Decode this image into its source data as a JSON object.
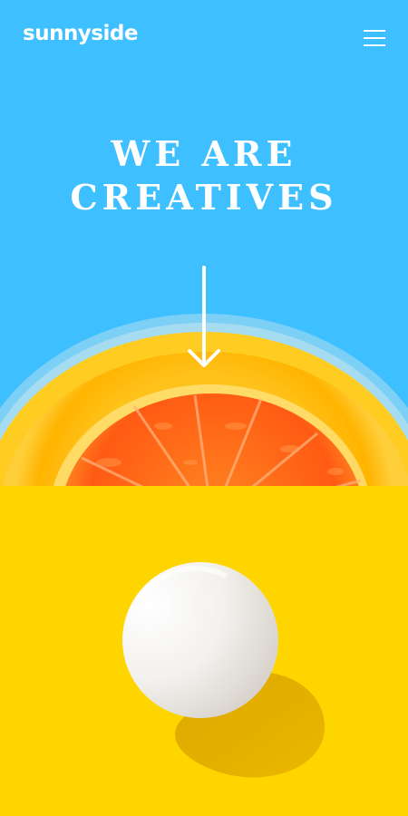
{
  "header": {
    "logo": "sunnyside",
    "menu_icon": "hamburger-menu-icon"
  },
  "hero": {
    "headline_line1": "WE ARE",
    "headline_line2": "CREATIVES",
    "scroll_icon": "arrow-down-icon",
    "image": "orange-slice-in-bowl"
  },
  "feature": {
    "image": "egg-on-yellow-background"
  },
  "colors": {
    "hero_background": "#3ebfff",
    "feature_background": "#ffd500",
    "orange": "#ff6a1a",
    "text": "#ffffff"
  }
}
